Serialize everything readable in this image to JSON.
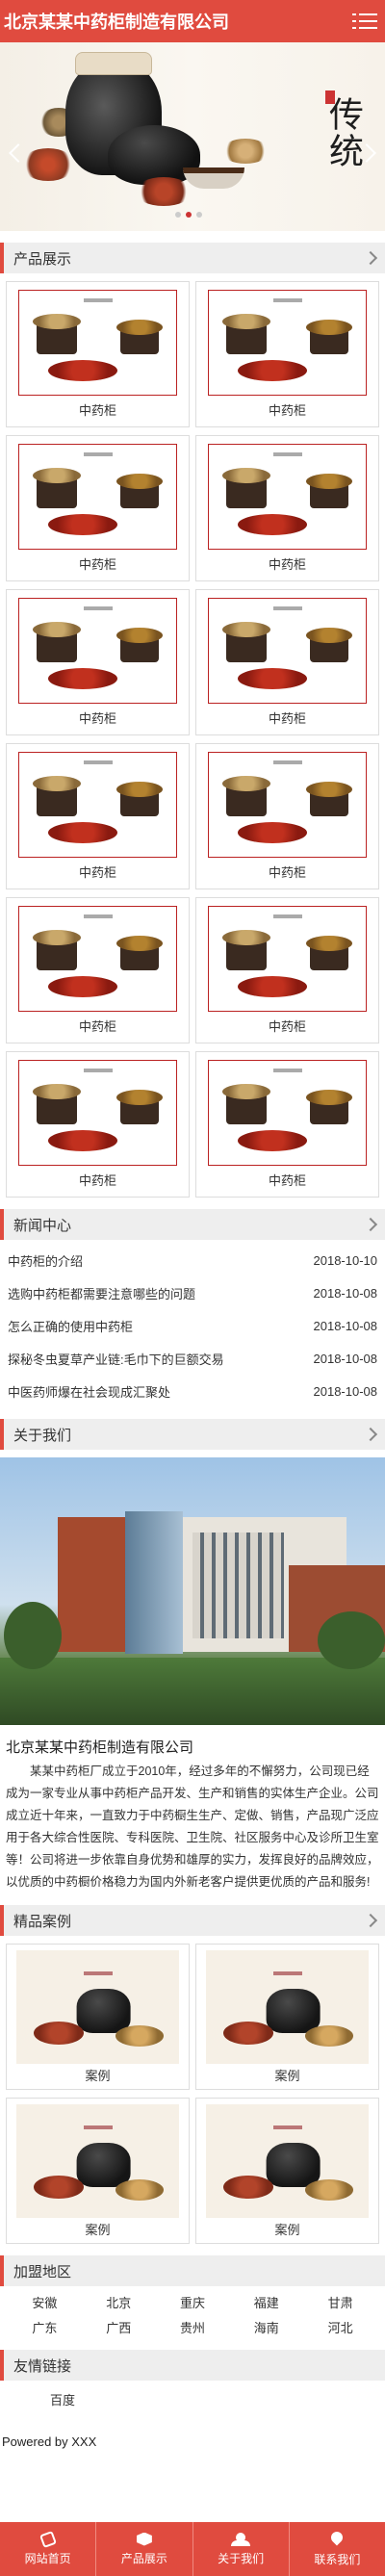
{
  "header": {
    "site_title": "北京某某中药柜制造有限公司",
    "menu_icon": "menu-icon"
  },
  "banner": {
    "calligraphy": "传统"
  },
  "products": {
    "section_title": "产品展示",
    "items": [
      "中药柜",
      "中药柜",
      "中药柜",
      "中药柜",
      "中药柜",
      "中药柜",
      "中药柜",
      "中药柜",
      "中药柜",
      "中药柜",
      "中药柜",
      "中药柜"
    ]
  },
  "news": {
    "section_title": "新闻中心",
    "items": [
      {
        "title": "中药柜的介绍",
        "date": "2018-10-10"
      },
      {
        "title": "选购中药柜都需要注意哪些的问题",
        "date": "2018-10-08"
      },
      {
        "title": "怎么正确的使用中药柜",
        "date": "2018-10-08"
      },
      {
        "title": "探秘冬虫夏草产业链:毛巾下的巨额交易",
        "date": "2018-10-08"
      },
      {
        "title": "中医药师爆在社会现成汇聚处",
        "date": "2018-10-08"
      }
    ]
  },
  "about": {
    "section_title": "关于我们",
    "company_name": "北京某某中药柜制造有限公司",
    "text": "某某中药柜厂成立于2010年，经过多年的不懈努力，公司现已经成为一家专业从事中药柜产品开发、生产和销售的实体生产企业。公司成立近十年来，一直致力于中药橱生生产、定做、销售，产品现广泛应用于各大综合性医院、专科医院、卫生院、社区服务中心及诊所卫生室等！公司将进一步依靠自身优势和雄厚的实力，发挥良好的品牌效应，以优质的中药橱价格稳力为国内外新老客户提供更优质的产品和服务!"
  },
  "cases": {
    "section_title": "精品案例",
    "items": [
      "案例",
      "案例",
      "案例",
      "案例"
    ]
  },
  "regions": {
    "section_title": "加盟地区",
    "items": [
      "安徽",
      "北京",
      "重庆",
      "福建",
      "甘肃",
      "广东",
      "广西",
      "贵州",
      "海南",
      "河北"
    ]
  },
  "links": {
    "section_title": "友情链接",
    "items": [
      "百度"
    ]
  },
  "footer": {
    "powered": "Powered by XXX",
    "nav": [
      {
        "label": "网站首页",
        "icon": "phone-icon"
      },
      {
        "label": "产品展示",
        "icon": "box-icon"
      },
      {
        "label": "关于我们",
        "icon": "users-icon"
      },
      {
        "label": "联系我们",
        "icon": "location-icon"
      }
    ]
  },
  "colors": {
    "brand": "#e04b3f",
    "section_bg": "#eeeeee"
  }
}
